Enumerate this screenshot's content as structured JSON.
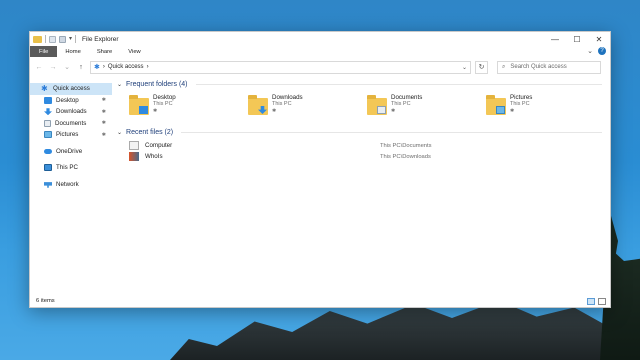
{
  "window": {
    "title": "File Explorer",
    "controls": {
      "minimize": "—",
      "maximize": "☐",
      "close": "✕"
    }
  },
  "ribbon": {
    "tabs": [
      "File",
      "Home",
      "Share",
      "View"
    ]
  },
  "address": {
    "back": "←",
    "forward": "→",
    "recent": "⌄",
    "up": "↑",
    "pin_glyph": "✱",
    "sep1": "›",
    "path_label": "Quick access",
    "sep2": "›",
    "dropdown": "⌄",
    "refresh": "↻"
  },
  "search": {
    "placeholder": "Search Quick access",
    "icon": "⌕"
  },
  "sidebar": {
    "items": [
      {
        "label": "Quick access",
        "icon": "star-icon"
      },
      {
        "label": "Desktop",
        "icon": "desktop-icon",
        "pin": "📌"
      },
      {
        "label": "Downloads",
        "icon": "downloads-icon",
        "pin": "📌"
      },
      {
        "label": "Documents",
        "icon": "documents-icon",
        "pin": "📌"
      },
      {
        "label": "Pictures",
        "icon": "pictures-icon",
        "pin": "📌"
      },
      {
        "label": "OneDrive",
        "icon": "onedrive-icon"
      },
      {
        "label": "This PC",
        "icon": "this-pc-icon"
      },
      {
        "label": "Network",
        "icon": "network-icon"
      }
    ]
  },
  "frequent": {
    "header": "Frequent folders (4)",
    "folders": [
      {
        "name": "Desktop",
        "location": "This PC",
        "pin": "📌"
      },
      {
        "name": "Downloads",
        "location": "This PC",
        "pin": "📌"
      },
      {
        "name": "Documents",
        "location": "This PC",
        "pin": "📌"
      },
      {
        "name": "Pictures",
        "location": "This PC",
        "pin": "📌"
      }
    ]
  },
  "recent": {
    "header": "Recent files (2)",
    "files": [
      {
        "name": "Computer",
        "path": "This PC\\Documents"
      },
      {
        "name": "WhoIs",
        "path": "This PC\\Downloads"
      }
    ]
  },
  "status": {
    "item_count": "6 items"
  },
  "colors": {
    "accent": "#0078d7",
    "selection": "#cce4f7",
    "section_header": "#1f3f7a",
    "folder": "#f3c756"
  }
}
